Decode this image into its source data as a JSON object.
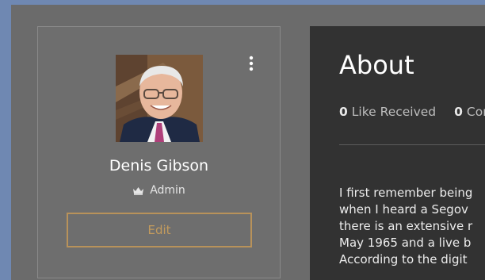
{
  "profile": {
    "name": "Denis Gibson",
    "role": "Admin",
    "edit_label": "Edit"
  },
  "about": {
    "title": "About",
    "stats": [
      {
        "count": "0",
        "label": "Like Received"
      },
      {
        "count": "0",
        "label": "Con"
      }
    ],
    "bio_lines": [
      "I first remember being",
      "when I heard a Segov",
      "there is an extensive r",
      "May 1965 and a live b",
      "According to the digit"
    ]
  },
  "icons": {
    "menu": "kebab-menu-icon",
    "role": "crown-icon"
  },
  "colors": {
    "frame": "#6f88b2",
    "accent": "#c29a5d",
    "panel": "#323232"
  }
}
